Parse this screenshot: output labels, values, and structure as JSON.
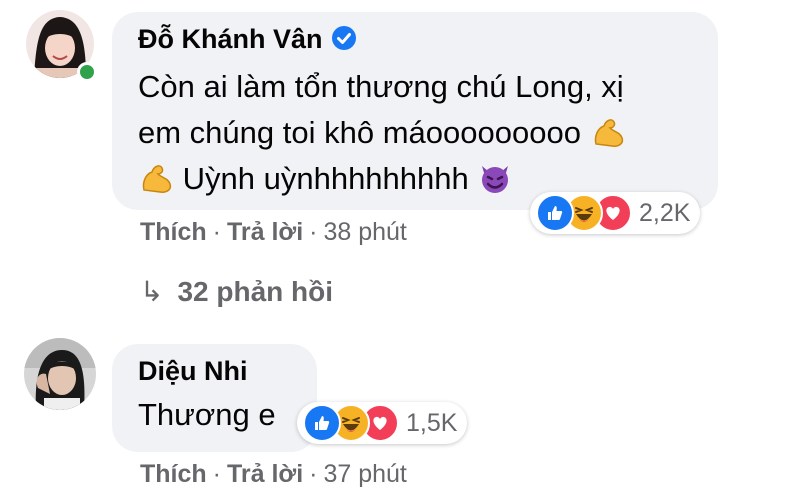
{
  "comments": [
    {
      "author": "Đỗ Khánh Vân",
      "verified": true,
      "lines": [
        "Còn ai làm tổn thương chú Long, xị",
        "em chúng toi khô máooooooooo",
        "Uỳnh uỳnhhhhhhhhh"
      ],
      "reaction_icons": [
        "like-icon",
        "haha-icon",
        "love-icon"
      ],
      "reaction_count": "2,2K",
      "actions": {
        "like": "Thích",
        "reply": "Trả lời",
        "time": "38 phút"
      },
      "replies_label": "32 phản hồi"
    },
    {
      "author": "Diệu Nhi",
      "verified": false,
      "lines": [
        "Thương e"
      ],
      "reaction_icons": [
        "like-icon",
        "haha-icon",
        "love-icon"
      ],
      "reaction_count": "1,5K",
      "actions": {
        "like": "Thích",
        "reply": "Trả lời",
        "time": "37 phút"
      }
    }
  ],
  "colors": {
    "like": "#1877f2",
    "haha": "#f7b125",
    "love": "#f33e58",
    "bubble": "#f0f2f5",
    "meta": "#65676b",
    "online": "#31a24c"
  }
}
